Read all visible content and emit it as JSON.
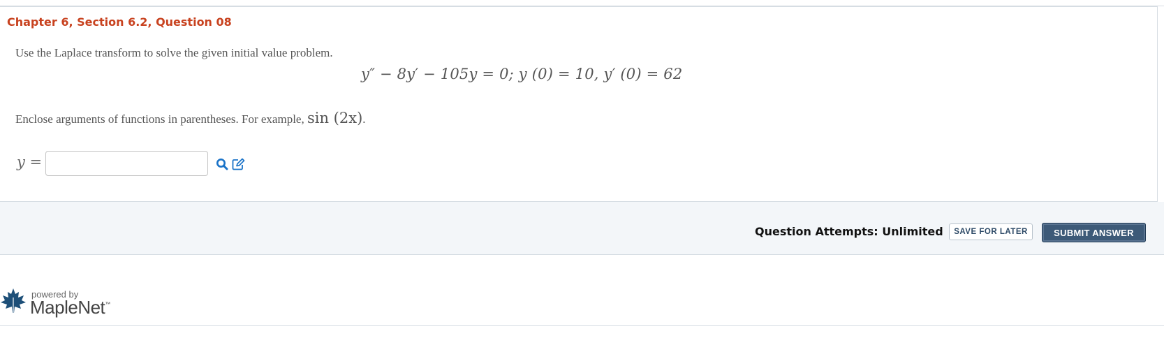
{
  "question": {
    "title": "Chapter 6, Section 6.2, Question 08",
    "prompt": "Use the Laplace transform to solve the given initial value problem.",
    "equation": "y″ − 8y′ − 105y = 0;  y (0) = 10,  y′ (0) = 62",
    "hint_text": "Enclose arguments of functions in parentheses. For example, ",
    "hint_math": "sin (2x)",
    "hint_end": ".",
    "answer_label": "y =",
    "answer_value": "",
    "answer_placeholder": ""
  },
  "footer": {
    "attempts": "Question Attempts: Unlimited",
    "save_label": "SAVE FOR LATER",
    "submit_label": "SUBMIT ANSWER"
  },
  "branding": {
    "powered_by": "powered by",
    "name": "MapleNet",
    "trademark": "™"
  },
  "icons": {
    "preview": "magnifier-icon",
    "edit": "edit-icon",
    "logo": "maple-leaf-icon"
  },
  "colors": {
    "title": "#c8421f",
    "icon_blue": "#1a73c8",
    "submit_bg": "#3d5a78"
  }
}
